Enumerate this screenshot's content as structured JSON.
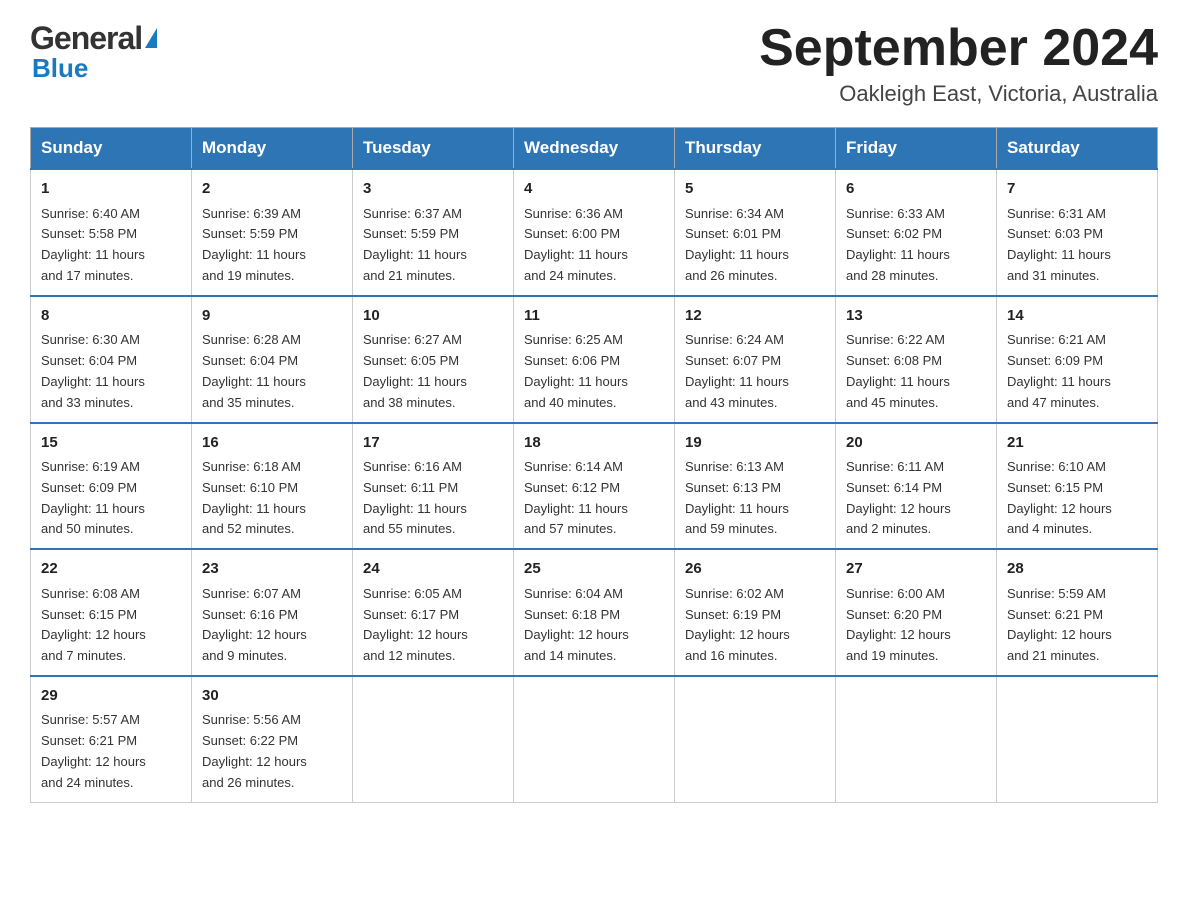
{
  "header": {
    "logo_general": "General",
    "logo_blue": "Blue",
    "month_title": "September 2024",
    "location": "Oakleigh East, Victoria, Australia"
  },
  "days_of_week": [
    "Sunday",
    "Monday",
    "Tuesday",
    "Wednesday",
    "Thursday",
    "Friday",
    "Saturday"
  ],
  "weeks": [
    [
      {
        "day": "1",
        "sunrise": "6:40 AM",
        "sunset": "5:58 PM",
        "daylight": "11 hours and 17 minutes."
      },
      {
        "day": "2",
        "sunrise": "6:39 AM",
        "sunset": "5:59 PM",
        "daylight": "11 hours and 19 minutes."
      },
      {
        "day": "3",
        "sunrise": "6:37 AM",
        "sunset": "5:59 PM",
        "daylight": "11 hours and 21 minutes."
      },
      {
        "day": "4",
        "sunrise": "6:36 AM",
        "sunset": "6:00 PM",
        "daylight": "11 hours and 24 minutes."
      },
      {
        "day": "5",
        "sunrise": "6:34 AM",
        "sunset": "6:01 PM",
        "daylight": "11 hours and 26 minutes."
      },
      {
        "day": "6",
        "sunrise": "6:33 AM",
        "sunset": "6:02 PM",
        "daylight": "11 hours and 28 minutes."
      },
      {
        "day": "7",
        "sunrise": "6:31 AM",
        "sunset": "6:03 PM",
        "daylight": "11 hours and 31 minutes."
      }
    ],
    [
      {
        "day": "8",
        "sunrise": "6:30 AM",
        "sunset": "6:04 PM",
        "daylight": "11 hours and 33 minutes."
      },
      {
        "day": "9",
        "sunrise": "6:28 AM",
        "sunset": "6:04 PM",
        "daylight": "11 hours and 35 minutes."
      },
      {
        "day": "10",
        "sunrise": "6:27 AM",
        "sunset": "6:05 PM",
        "daylight": "11 hours and 38 minutes."
      },
      {
        "day": "11",
        "sunrise": "6:25 AM",
        "sunset": "6:06 PM",
        "daylight": "11 hours and 40 minutes."
      },
      {
        "day": "12",
        "sunrise": "6:24 AM",
        "sunset": "6:07 PM",
        "daylight": "11 hours and 43 minutes."
      },
      {
        "day": "13",
        "sunrise": "6:22 AM",
        "sunset": "6:08 PM",
        "daylight": "11 hours and 45 minutes."
      },
      {
        "day": "14",
        "sunrise": "6:21 AM",
        "sunset": "6:09 PM",
        "daylight": "11 hours and 47 minutes."
      }
    ],
    [
      {
        "day": "15",
        "sunrise": "6:19 AM",
        "sunset": "6:09 PM",
        "daylight": "11 hours and 50 minutes."
      },
      {
        "day": "16",
        "sunrise": "6:18 AM",
        "sunset": "6:10 PM",
        "daylight": "11 hours and 52 minutes."
      },
      {
        "day": "17",
        "sunrise": "6:16 AM",
        "sunset": "6:11 PM",
        "daylight": "11 hours and 55 minutes."
      },
      {
        "day": "18",
        "sunrise": "6:14 AM",
        "sunset": "6:12 PM",
        "daylight": "11 hours and 57 minutes."
      },
      {
        "day": "19",
        "sunrise": "6:13 AM",
        "sunset": "6:13 PM",
        "daylight": "11 hours and 59 minutes."
      },
      {
        "day": "20",
        "sunrise": "6:11 AM",
        "sunset": "6:14 PM",
        "daylight": "12 hours and 2 minutes."
      },
      {
        "day": "21",
        "sunrise": "6:10 AM",
        "sunset": "6:15 PM",
        "daylight": "12 hours and 4 minutes."
      }
    ],
    [
      {
        "day": "22",
        "sunrise": "6:08 AM",
        "sunset": "6:15 PM",
        "daylight": "12 hours and 7 minutes."
      },
      {
        "day": "23",
        "sunrise": "6:07 AM",
        "sunset": "6:16 PM",
        "daylight": "12 hours and 9 minutes."
      },
      {
        "day": "24",
        "sunrise": "6:05 AM",
        "sunset": "6:17 PM",
        "daylight": "12 hours and 12 minutes."
      },
      {
        "day": "25",
        "sunrise": "6:04 AM",
        "sunset": "6:18 PM",
        "daylight": "12 hours and 14 minutes."
      },
      {
        "day": "26",
        "sunrise": "6:02 AM",
        "sunset": "6:19 PM",
        "daylight": "12 hours and 16 minutes."
      },
      {
        "day": "27",
        "sunrise": "6:00 AM",
        "sunset": "6:20 PM",
        "daylight": "12 hours and 19 minutes."
      },
      {
        "day": "28",
        "sunrise": "5:59 AM",
        "sunset": "6:21 PM",
        "daylight": "12 hours and 21 minutes."
      }
    ],
    [
      {
        "day": "29",
        "sunrise": "5:57 AM",
        "sunset": "6:21 PM",
        "daylight": "12 hours and 24 minutes."
      },
      {
        "day": "30",
        "sunrise": "5:56 AM",
        "sunset": "6:22 PM",
        "daylight": "12 hours and 26 minutes."
      },
      null,
      null,
      null,
      null,
      null
    ]
  ],
  "labels": {
    "sunrise": "Sunrise:",
    "sunset": "Sunset:",
    "daylight": "Daylight:"
  }
}
